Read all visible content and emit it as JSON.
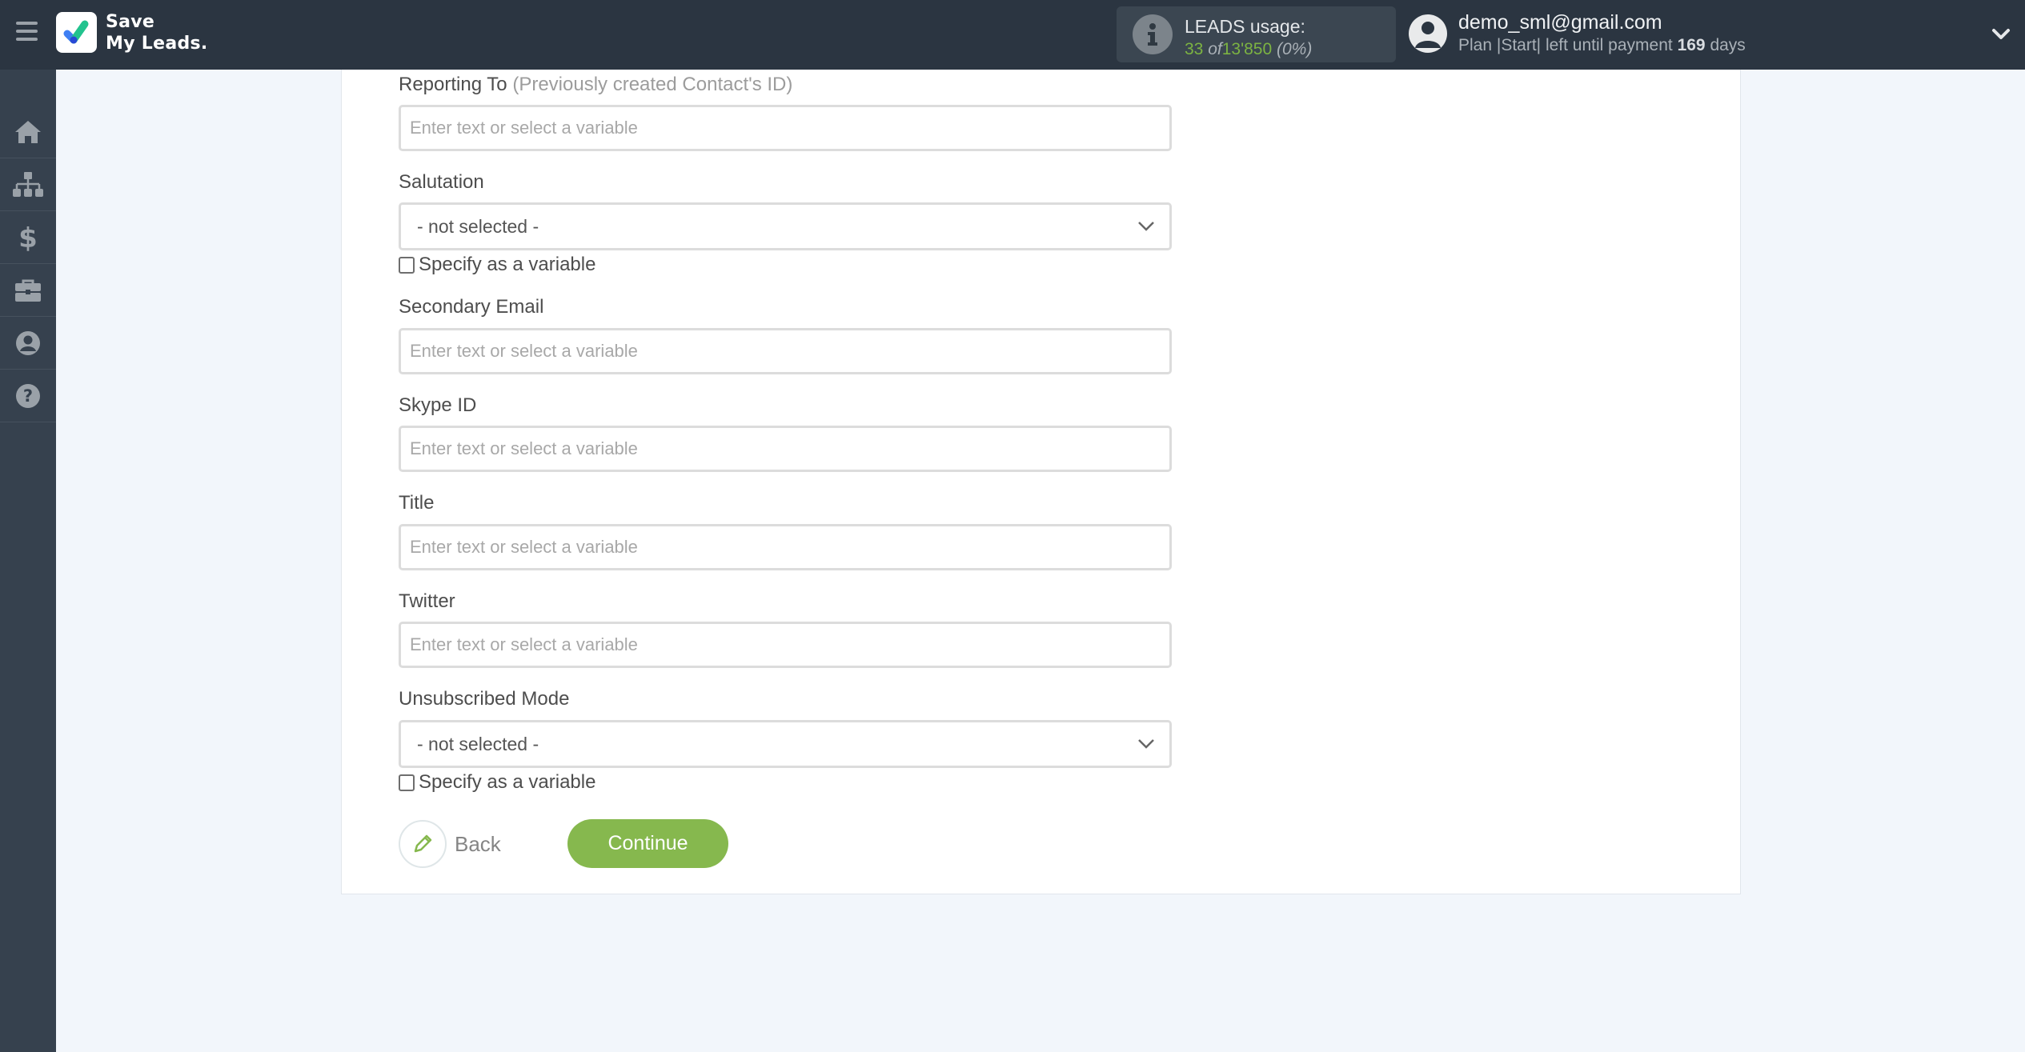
{
  "header": {
    "logo_line1": "Save",
    "logo_line2": "My Leads.",
    "usage": {
      "title": "LEADS usage:",
      "used": "33",
      "of": "of",
      "total": "13'850",
      "percent": "(0%)"
    },
    "user": {
      "email": "demo_sml@gmail.com",
      "plan_prefix": "Plan |Start| left until payment",
      "days": "169",
      "days_suffix": "days"
    }
  },
  "sidebar": {
    "items": [
      {
        "name": "home",
        "icon": "home-icon"
      },
      {
        "name": "connections",
        "icon": "sitemap-icon"
      },
      {
        "name": "billing",
        "icon": "dollar-icon"
      },
      {
        "name": "tools",
        "icon": "briefcase-icon"
      },
      {
        "name": "account",
        "icon": "user-circle-icon"
      },
      {
        "name": "help",
        "icon": "question-circle-icon"
      }
    ]
  },
  "form": {
    "reporting_to": {
      "label": "Reporting To",
      "hint": "(Previously created Contact's ID)",
      "placeholder": "Enter text or select a variable"
    },
    "salutation": {
      "label": "Salutation",
      "value": "- not selected -",
      "checkbox": "Specify as a variable"
    },
    "secondary_email": {
      "label": "Secondary Email",
      "placeholder": "Enter text or select a variable"
    },
    "skype_id": {
      "label": "Skype ID",
      "placeholder": "Enter text or select a variable"
    },
    "title": {
      "label": "Title",
      "placeholder": "Enter text or select a variable"
    },
    "twitter": {
      "label": "Twitter",
      "placeholder": "Enter text or select a variable"
    },
    "unsubscribed_mode": {
      "label": "Unsubscribed Mode",
      "value": "- not selected -",
      "checkbox": "Specify as a variable"
    },
    "back_label": "Back",
    "continue_label": "Continue"
  },
  "colors": {
    "accent_green": "#86b84e",
    "header_bg": "#2b3541",
    "sidebar_bg": "#36414e"
  }
}
